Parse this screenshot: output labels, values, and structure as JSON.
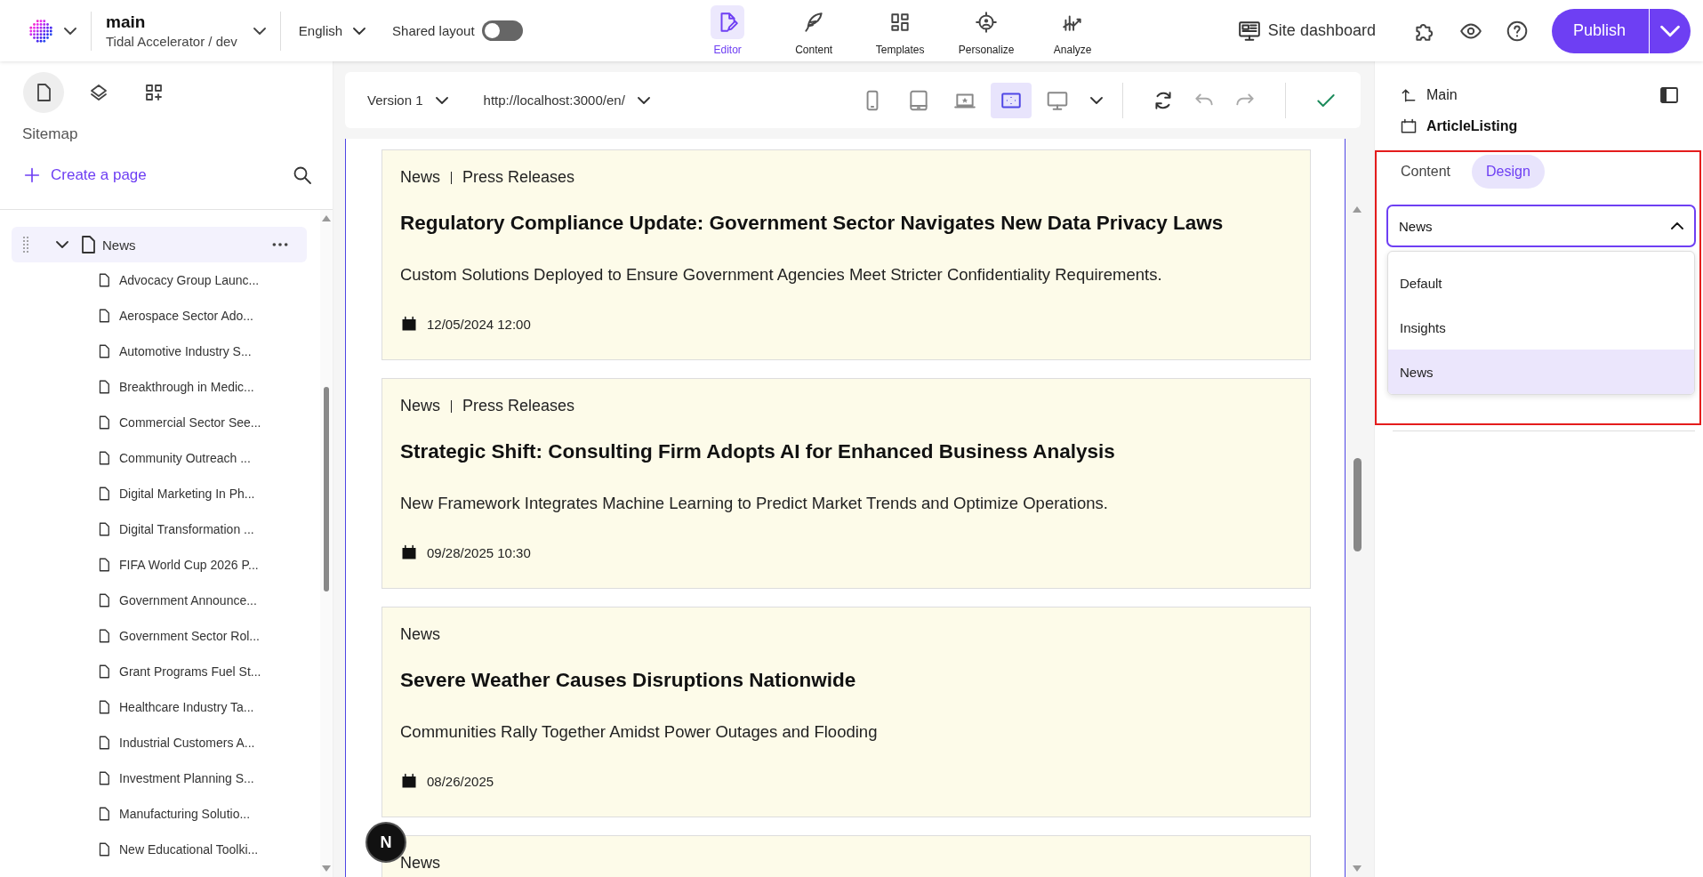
{
  "top_bar": {
    "branch": "main",
    "project": "Tidal Accelerator / dev",
    "language": "English",
    "shared_layout": {
      "label": "Shared layout",
      "on": false
    },
    "nav": [
      {
        "label": "Editor",
        "selected": true
      },
      {
        "label": "Content",
        "selected": false
      },
      {
        "label": "Templates",
        "selected": false
      },
      {
        "label": "Personalize",
        "selected": false
      },
      {
        "label": "Analyze",
        "selected": false
      }
    ],
    "site_dashboard": "Site dashboard",
    "publish": "Publish"
  },
  "sidebar": {
    "tabs": [
      {
        "selected": true
      },
      {
        "selected": false
      },
      {
        "selected": false
      }
    ],
    "title": "Sitemap",
    "create_page": "Create a page",
    "tree": [
      {
        "label": "News",
        "expanded": true,
        "selected": true,
        "children": [
          {
            "label": "Advocacy Group Launc..."
          },
          {
            "label": "Aerospace Sector Ado..."
          },
          {
            "label": "Automotive Industry S..."
          },
          {
            "label": "Breakthrough in Medic..."
          },
          {
            "label": "Commercial Sector See..."
          },
          {
            "label": "Community Outreach ..."
          },
          {
            "label": "Digital Marketing In Ph..."
          },
          {
            "label": "Digital Transformation ..."
          },
          {
            "label": "FIFA World Cup 2026 P..."
          },
          {
            "label": "Government Announce..."
          },
          {
            "label": "Government Sector Rol..."
          },
          {
            "label": "Grant Programs Fuel St..."
          },
          {
            "label": "Healthcare Industry Ta..."
          },
          {
            "label": "Industrial Customers A..."
          },
          {
            "label": "Investment Planning S..."
          },
          {
            "label": "Manufacturing Solutio..."
          },
          {
            "label": "New Educational Toolki..."
          }
        ]
      }
    ]
  },
  "canvas_toolbar": {
    "version": "Version 1",
    "url": "http://localhost:3000/en/",
    "devices": [
      {
        "kind": "phone",
        "selected": false
      },
      {
        "kind": "tablet",
        "selected": false
      },
      {
        "kind": "laptop",
        "selected": false
      },
      {
        "kind": "fit",
        "selected": true
      },
      {
        "kind": "desktop",
        "selected": false
      }
    ]
  },
  "articles": [
    {
      "tags": [
        "News",
        "Press Releases"
      ],
      "title": "Regulatory Compliance Update: Government Sector Navigates New Data Privacy Laws",
      "summary": "Custom Solutions Deployed to Ensure Government Agencies Meet Stricter Confidentiality Requirements.",
      "date": "12/05/2024 12:00"
    },
    {
      "tags": [
        "News",
        "Press Releases"
      ],
      "title": "Strategic Shift: Consulting Firm Adopts AI for Enhanced Business Analysis",
      "summary": "New Framework Integrates Machine Learning to Predict Market Trends and Optimize Operations.",
      "date": "09/28/2025 10:30"
    },
    {
      "tags": [
        "News"
      ],
      "title": "Severe Weather Causes Disruptions Nationwide",
      "summary": "Communities Rally Together Amidst Power Outages and Flooding",
      "date": "08/26/2025"
    },
    {
      "tags": [
        "News"
      ]
    }
  ],
  "dev_badge": "N",
  "properties_panel": {
    "parent": "Main",
    "component": "ArticleListing",
    "tabs": [
      {
        "label": "Content",
        "selected": false
      },
      {
        "label": "Design",
        "selected": true
      }
    ],
    "variant_select": {
      "value": "News",
      "expanded": true,
      "options": [
        {
          "label": "Default",
          "selected": false
        },
        {
          "label": "Insights",
          "selected": false
        },
        {
          "label": "News",
          "selected": true
        }
      ]
    }
  }
}
